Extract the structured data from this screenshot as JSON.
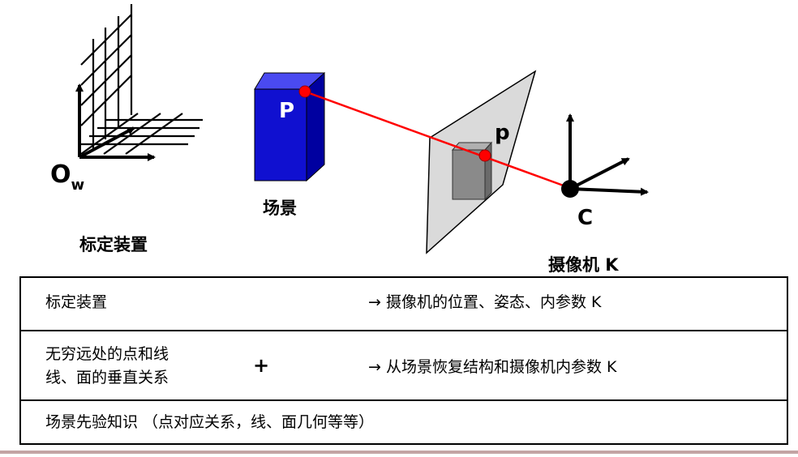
{
  "diagram": {
    "origin_label": "O",
    "origin_subscript": "w",
    "calibration_label": "标定装置",
    "scene_label": "场景",
    "scene_point": "P",
    "image_point": "p",
    "camera_center": "C",
    "camera_label": "摄像机 K",
    "colors": {
      "box_blue": "#1010d0",
      "ray_red": "#ff0000",
      "plane_gray": "#dadada",
      "image_box": "#8a8a8a"
    }
  },
  "table": {
    "row1": {
      "left": "标定装置",
      "right": "→ 摄像机的位置、姿态、内参数 K"
    },
    "row2": {
      "left_line1": "无穷远处的点和线",
      "left_line2": "线、面的垂直关系",
      "plus": "+",
      "right": "→ 从场景恢复结构和摄像机内参数 K"
    },
    "row3": {
      "text": "场景先验知识 （点对应关系，线、面几何等等）"
    }
  }
}
